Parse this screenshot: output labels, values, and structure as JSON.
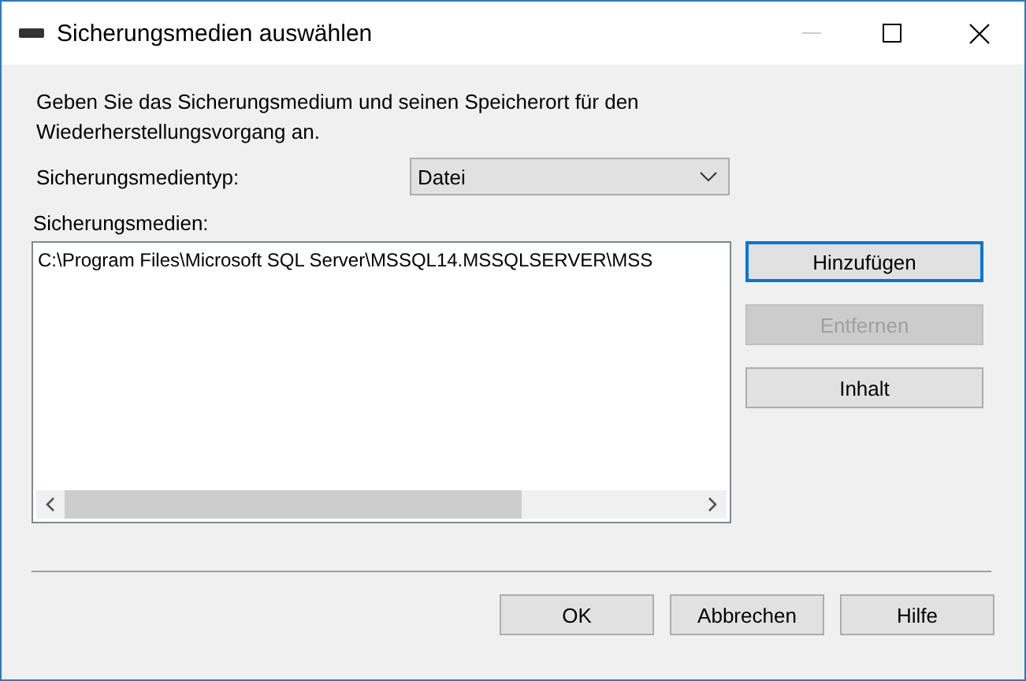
{
  "window": {
    "title": "Sicherungsmedien auswählen",
    "minimize_disabled": true
  },
  "instructions": "Geben Sie das Sicherungsmedium und seinen Speicherort für den Wiederherstellungsvorgang an.",
  "media_type": {
    "label": "Sicherungsmedientyp:",
    "value": "Datei"
  },
  "media_list": {
    "label": "Sicherungsmedien:",
    "items": [
      "C:\\Program Files\\Microsoft SQL Server\\MSSQL14.MSSQLSERVER\\MSS"
    ]
  },
  "side_buttons": [
    {
      "label": "Hinzufügen",
      "disabled": false,
      "focused": true
    },
    {
      "label": "Entfernen",
      "disabled": true,
      "focused": false
    },
    {
      "label": "Inhalt",
      "disabled": false,
      "focused": false
    }
  ],
  "buttons": [
    "OK",
    "Abbrechen",
    "Hilfe"
  ]
}
